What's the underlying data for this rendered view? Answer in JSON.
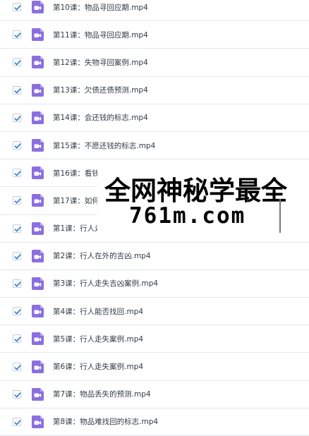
{
  "files": [
    {
      "name": "第10课：物品寻回应期.mp4",
      "checked": true,
      "icon": "video-file-icon"
    },
    {
      "name": "第11课：物品寻回应期.mp4",
      "checked": true,
      "icon": "video-file-icon"
    },
    {
      "name": "第12课：失物寻回案例.mp4",
      "checked": true,
      "icon": "video-file-icon"
    },
    {
      "name": "第13课：欠债还债预测.mp4",
      "checked": true,
      "icon": "video-file-icon"
    },
    {
      "name": "第14课：会还钱的标志.mp4",
      "checked": true,
      "icon": "video-file-icon"
    },
    {
      "name": "第15课：不愿还钱的标志.mp4",
      "checked": true,
      "icon": "video-file-icon"
    },
    {
      "name": "第16课：看钱",
      "checked": true,
      "icon": "video-file-icon"
    },
    {
      "name": "第17课：如何",
      "checked": true,
      "icon": "video-file-icon"
    },
    {
      "name": "第1课：行人走",
      "checked": true,
      "icon": "video-file-icon"
    },
    {
      "name": "第2课：行人在外的吉凶.mp4",
      "checked": true,
      "icon": "video-file-icon"
    },
    {
      "name": "第3课：行人走失吉凶案例.mp4",
      "checked": true,
      "icon": "video-file-icon"
    },
    {
      "name": "第4课：行人能否找回.mp4",
      "checked": true,
      "icon": "video-file-icon"
    },
    {
      "name": "第5课：行人走失案例.mp4",
      "checked": true,
      "icon": "video-file-icon"
    },
    {
      "name": "第6课：行人走失案例.mp4",
      "checked": true,
      "icon": "video-file-icon"
    },
    {
      "name": "第7课：物品丢失的预测.mp4",
      "checked": true,
      "icon": "video-file-icon"
    },
    {
      "name": "第8课：物品难找回的标志.mp4",
      "checked": true,
      "icon": "video-file-icon"
    }
  ],
  "watermark": {
    "line1": "全网神秘学最全",
    "line2": "761m.com"
  },
  "colors": {
    "icon_bg": "#8b6fe0",
    "check": "#2f7fd8",
    "divider": "#e4e6ea",
    "text": "#333a44"
  }
}
